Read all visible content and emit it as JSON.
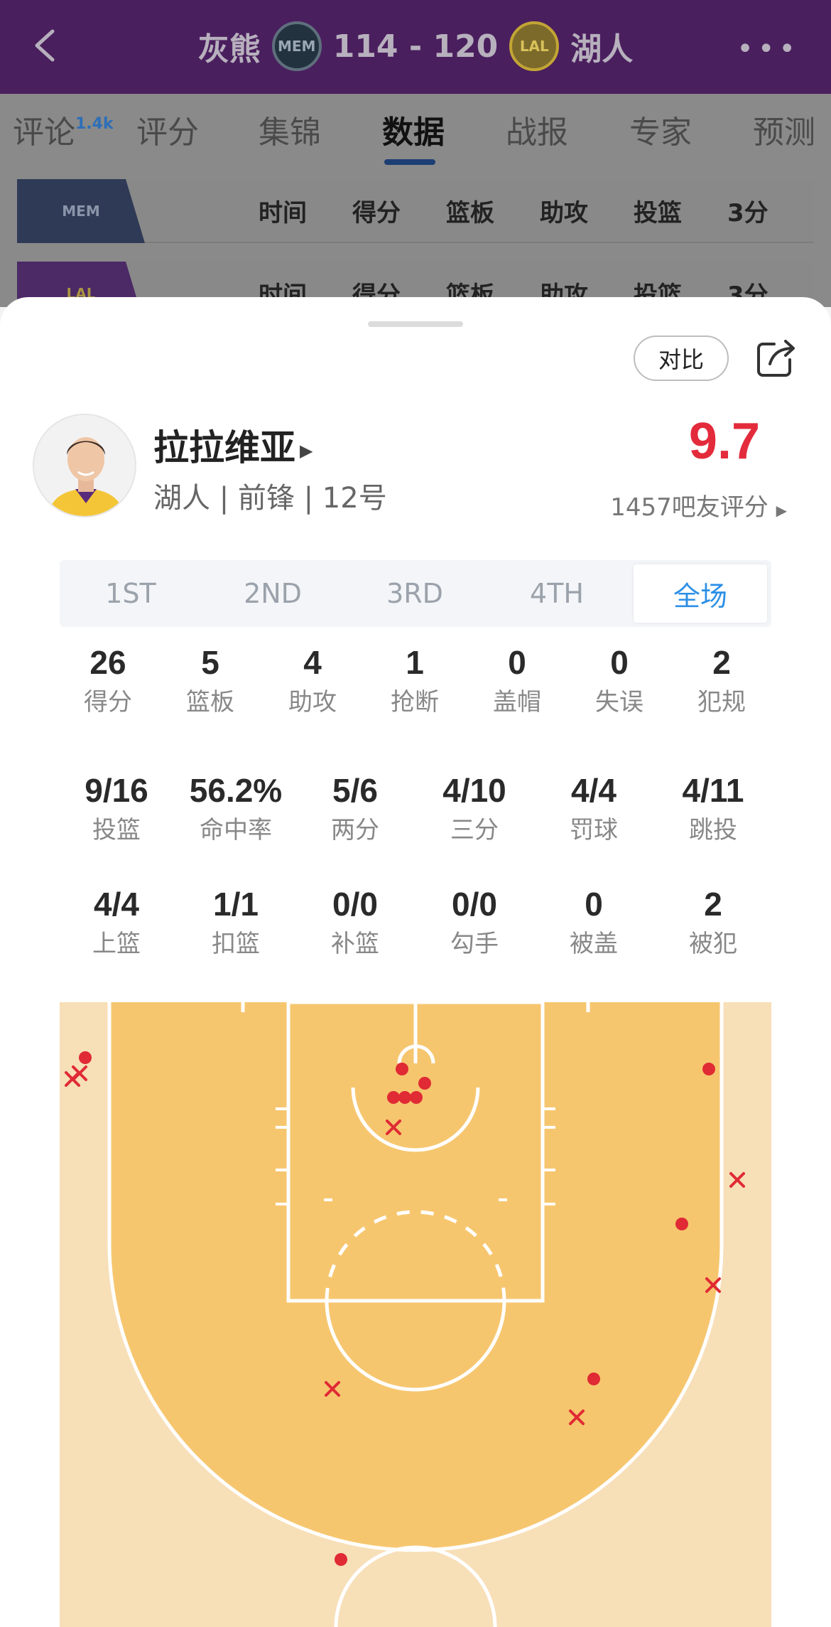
{
  "header": {
    "home_team": "灰熊",
    "home_logo": "MEM",
    "score": "114 - 120",
    "away_logo": "LAL",
    "away_team": "湖人"
  },
  "tabs": [
    {
      "label": "评论",
      "badge": "1.4k"
    },
    {
      "label": "评分"
    },
    {
      "label": "集锦"
    },
    {
      "label": "数据"
    },
    {
      "label": "战报"
    },
    {
      "label": "专家"
    },
    {
      "label": "预测"
    }
  ],
  "box_header": [
    "时间",
    "得分",
    "篮板",
    "助攻",
    "投篮",
    "3分"
  ],
  "row_logos": [
    "MEM",
    "LAL"
  ],
  "sheet": {
    "compare_label": "对比",
    "player_name": "拉拉维亚",
    "player_info": "湖人 | 前锋 | 12号",
    "rating": "9.7",
    "raters": "1457吧友评分",
    "periods": [
      "1ST",
      "2ND",
      "3RD",
      "4TH",
      "全场"
    ],
    "active_period": "全场"
  },
  "stats_row1": [
    {
      "value": "26",
      "label": "得分"
    },
    {
      "value": "5",
      "label": "篮板"
    },
    {
      "value": "4",
      "label": "助攻"
    },
    {
      "value": "1",
      "label": "抢断"
    },
    {
      "value": "0",
      "label": "盖帽"
    },
    {
      "value": "0",
      "label": "失误"
    },
    {
      "value": "2",
      "label": "犯规"
    }
  ],
  "stats_row2": [
    {
      "value": "9/16",
      "label": "投篮"
    },
    {
      "value": "56.2%",
      "label": "命中率"
    },
    {
      "value": "5/6",
      "label": "两分"
    },
    {
      "value": "4/10",
      "label": "三分"
    },
    {
      "value": "4/4",
      "label": "罚球"
    },
    {
      "value": "4/11",
      "label": "跳投"
    }
  ],
  "stats_row3": [
    {
      "value": "4/4",
      "label": "上篮"
    },
    {
      "value": "1/1",
      "label": "扣篮"
    },
    {
      "value": "0/0",
      "label": "补篮"
    },
    {
      "value": "0/0",
      "label": "勾手"
    },
    {
      "value": "0",
      "label": "被盖"
    },
    {
      "value": "2",
      "label": "被犯"
    }
  ],
  "shot_chart": {
    "colors": {
      "made": "#e02a34",
      "missed": "#e02a34",
      "court_outer": "#f7dfb8",
      "court_inner": "#f6c66f",
      "lines": "#ffffff"
    },
    "shots": [
      {
        "result": "made"
      },
      {
        "result": "missed"
      },
      {
        "result": "missed"
      },
      {
        "result": "made"
      },
      {
        "result": "made"
      },
      {
        "result": "made"
      },
      {
        "result": "made"
      },
      {
        "result": "made"
      },
      {
        "result": "made"
      },
      {
        "result": "missed"
      },
      {
        "result": "made"
      },
      {
        "result": "missed"
      },
      {
        "result": "made"
      },
      {
        "result": "missed"
      },
      {
        "result": "made"
      },
      {
        "result": "missed"
      },
      {
        "result": "missed"
      }
    ]
  }
}
